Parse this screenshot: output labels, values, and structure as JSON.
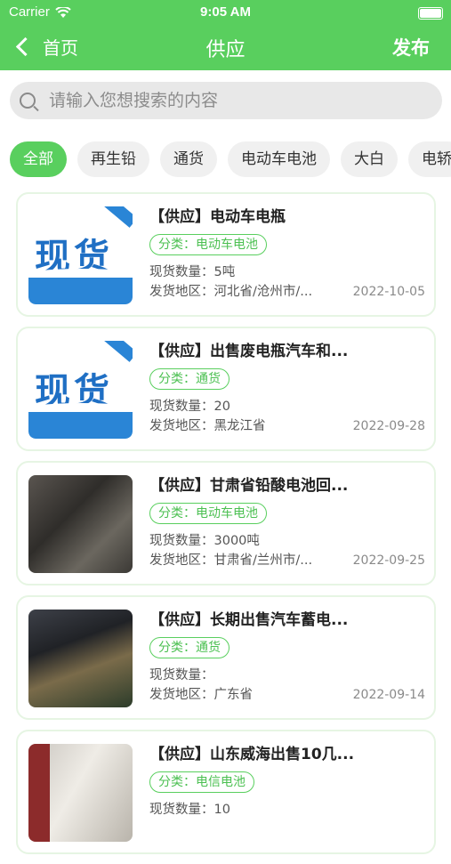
{
  "status_bar": {
    "carrier": "Carrier",
    "time": "9:05 AM"
  },
  "nav": {
    "back_label": "首页",
    "title": "供应",
    "publish_label": "发布"
  },
  "search": {
    "placeholder": "请输入您想搜索的内容"
  },
  "categories": [
    "全部",
    "再生铅",
    "通货",
    "电动车电池",
    "大白",
    "电轿"
  ],
  "active_category": "全部",
  "field_labels": {
    "quantity": "现货数量：",
    "region": "发货地区：",
    "category_prefix": "分类："
  },
  "listings": [
    {
      "title": "【供应】电动车电瓶",
      "category": "电动车电池",
      "quantity": "5吨",
      "region": "河北省/沧州市/...",
      "date": "2022-10-05",
      "image": "xianhuo",
      "image_text": "现货"
    },
    {
      "title": "【供应】出售废电瓶汽车和...",
      "category": "通货",
      "quantity": "20",
      "region": "黑龙江省",
      "date": "2022-09-28",
      "image": "xianhuo",
      "image_text": "现货"
    },
    {
      "title": "【供应】甘肃省铅酸电池回...",
      "category": "电动车电池",
      "quantity": "3000吨",
      "region": "甘肃省/兰州市/...",
      "date": "2022-09-25",
      "image": "photo1"
    },
    {
      "title": "【供应】长期出售汽车蓄电...",
      "category": "通货",
      "quantity": "",
      "region": "广东省",
      "date": "2022-09-14",
      "image": "photo2"
    },
    {
      "title": "【供应】山东威海出售10几...",
      "category": "电信电池",
      "quantity": "10",
      "region": "",
      "date": "",
      "image": "photo3"
    }
  ],
  "colors": {
    "accent": "#59cf5e",
    "tag_text": "#4cc052",
    "search_bg": "#e8e8e8",
    "chip_bg": "#f0f0f0"
  }
}
